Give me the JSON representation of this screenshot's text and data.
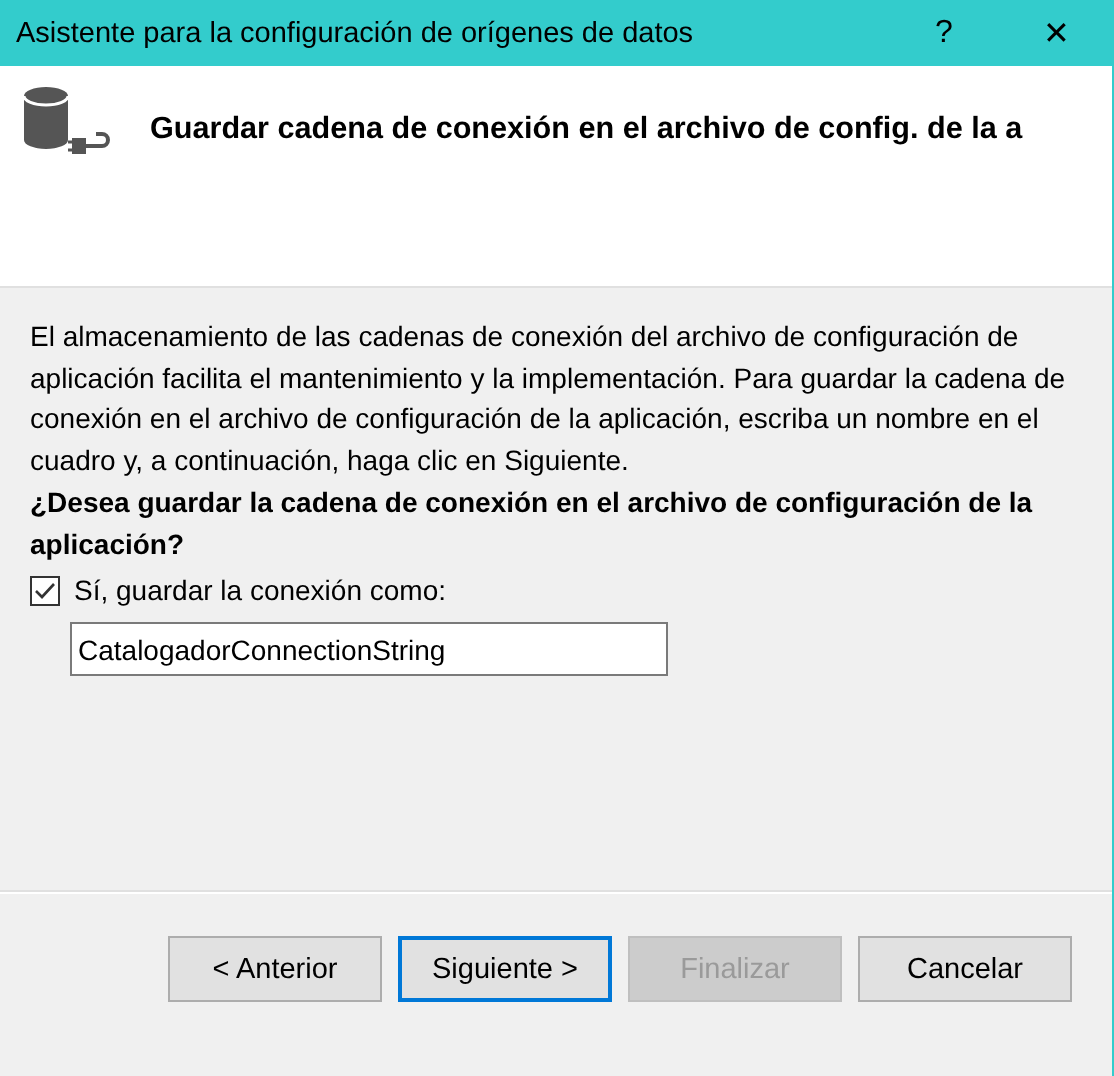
{
  "window": {
    "title": "Asistente para la configuración de orígenes de datos",
    "help": "?",
    "close": "✕"
  },
  "header": {
    "title": "Guardar cadena de conexión en el archivo de config. de la a"
  },
  "description": "El almacenamiento de las cadenas de conexión del archivo de configuración de aplicación facilita el mantenimiento y la implementación. Para guardar la cadena de conexión en el archivo de configuración de la aplicación, escriba un nombre en el cuadro y, a continuación, haga clic en Siguiente.",
  "question": "¿Desea guardar la cadena de conexión en el archivo de configuración de la aplicación?",
  "save_option": {
    "label": "Sí, guardar la conexión como:",
    "checked": true
  },
  "connection_name": {
    "value": "CatalogadorConnectionString"
  },
  "buttons": [
    {
      "label": "< Anterior",
      "focused": false,
      "disabled": false
    },
    {
      "label": "Siguiente >",
      "focused": true,
      "disabled": false
    },
    {
      "label": "Finalizar",
      "focused": false,
      "disabled": true
    },
    {
      "label": "Cancelar",
      "focused": false,
      "disabled": false
    }
  ]
}
